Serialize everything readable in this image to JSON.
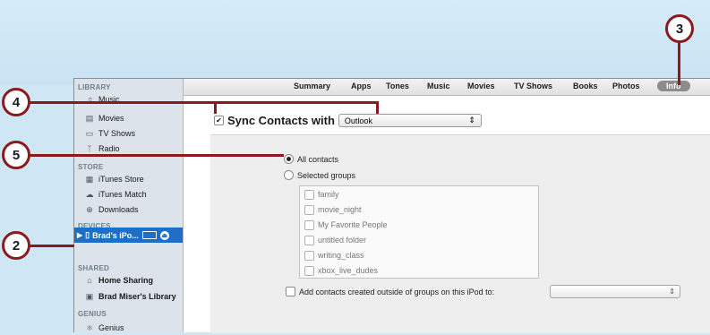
{
  "sidebar": {
    "library_header": "LIBRARY",
    "library_items": [
      {
        "label": "Music",
        "icon": "music-note-icon"
      },
      {
        "label": "Movies",
        "icon": "film-icon"
      },
      {
        "label": "TV Shows",
        "icon": "tv-icon"
      },
      {
        "label": "Radio",
        "icon": "radio-icon"
      }
    ],
    "store_header": "STORE",
    "store_items": [
      {
        "label": "iTunes Store",
        "icon": "store-icon"
      },
      {
        "label": "iTunes Match",
        "icon": "cloud-icon"
      },
      {
        "label": "Downloads",
        "icon": "download-icon"
      }
    ],
    "devices_header": "DEVICES",
    "device": {
      "label": "Brad's iPo..."
    },
    "shared_header": "SHARED",
    "shared_items": [
      {
        "label": "Home Sharing",
        "icon": "home-icon"
      },
      {
        "label": "Brad Miser's Library",
        "icon": "library-icon"
      }
    ],
    "genius_header": "GENIUS",
    "genius_items": [
      {
        "label": "Genius",
        "icon": "genius-icon"
      }
    ]
  },
  "tabs": [
    "Summary",
    "Apps",
    "Tones",
    "Music",
    "Movies",
    "TV Shows",
    "Books",
    "Photos",
    "Info"
  ],
  "active_tab": "Info",
  "sync": {
    "title": "Sync Contacts with",
    "source": "Outlook",
    "checked": true
  },
  "radios": {
    "all_contacts": "All contacts",
    "selected_groups": "Selected groups",
    "selected": "all_contacts"
  },
  "groups": [
    "family",
    "movie_night",
    "My Favorite People",
    "untitled folder",
    "writing_class",
    "xbox_live_dudes"
  ],
  "add_contacts_label": "Add contacts created outside of groups on this iPod to:",
  "callouts": [
    "2",
    "3",
    "4",
    "5"
  ],
  "colors": {
    "callout": "#8b1a1f",
    "selection": "#1d6ec6",
    "background": "#cfe6f4"
  }
}
